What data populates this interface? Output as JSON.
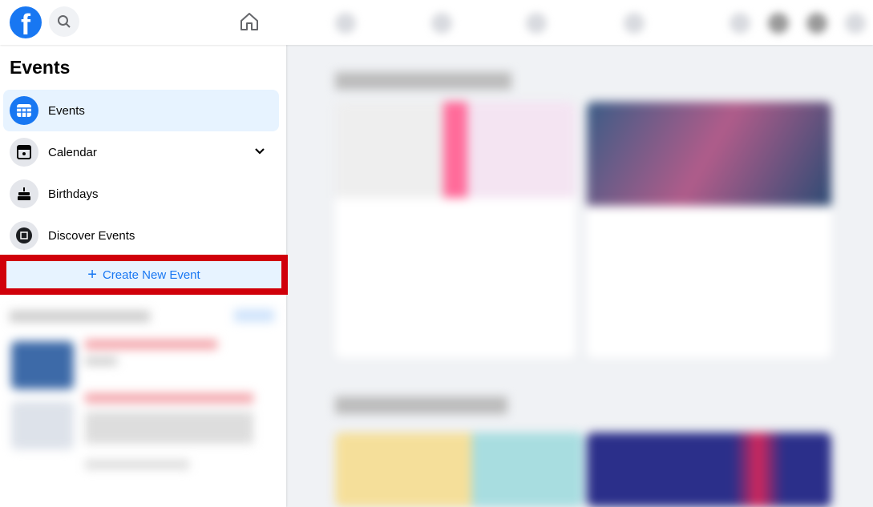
{
  "topbar": {
    "logo": "f",
    "search_icon": "search-icon",
    "home_icon": "home-icon"
  },
  "sidebar": {
    "title": "Events",
    "items": [
      {
        "label": "Events",
        "icon": "calendar-grid-icon",
        "active": true
      },
      {
        "label": "Calendar",
        "icon": "calendar-star-icon",
        "expandable": true
      },
      {
        "label": "Birthdays",
        "icon": "birthday-cake-icon"
      },
      {
        "label": "Discover Events",
        "icon": "discover-icon"
      }
    ],
    "create_button": "Create New Event"
  },
  "colors": {
    "accent": "#1877f2",
    "highlight": "#d0000a",
    "active_bg": "#e7f3ff"
  }
}
